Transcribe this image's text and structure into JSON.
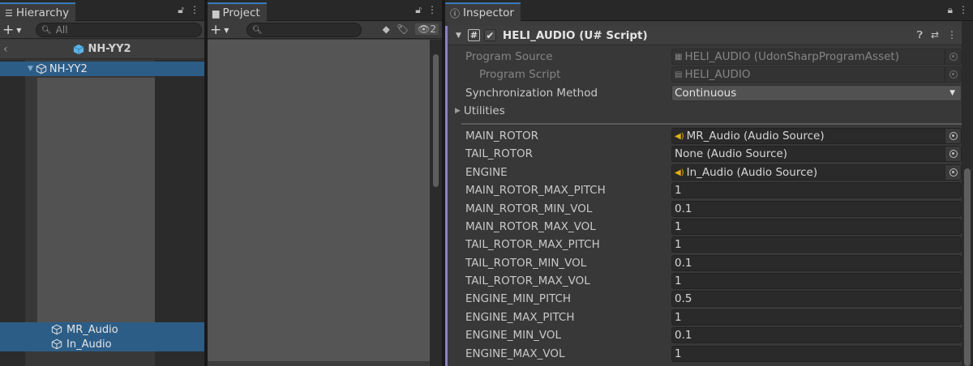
{
  "hierarchy": {
    "tab_label": "Hierarchy",
    "search_placeholder": "All",
    "scene_name": "NH-YY2",
    "items": [
      {
        "label": "NH-YY2"
      },
      {
        "label": "MR_Audio"
      },
      {
        "label": "In_Audio"
      }
    ]
  },
  "project": {
    "tab_label": "Project",
    "hidden_count": "2"
  },
  "inspector": {
    "tab_label": "Inspector",
    "component_title": "HELI_AUDIO (U# Script)",
    "program_source": {
      "label": "Program Source",
      "value": "HELI_AUDIO (UdonSharpProgramAsset)"
    },
    "program_script": {
      "label": "Program Script",
      "value": "HELI_AUDIO"
    },
    "sync_method": {
      "label": "Synchronization Method",
      "value": "Continuous"
    },
    "utilities_label": "Utilities",
    "fields": [
      {
        "label": "MAIN_ROTOR",
        "value": "MR_Audio (Audio Source)"
      },
      {
        "label": "TAIL_ROTOR",
        "value": "None (Audio Source)"
      },
      {
        "label": "ENGINE",
        "value": "In_Audio (Audio Source)"
      },
      {
        "label": "MAIN_ROTOR_MAX_PITCH",
        "value": "1"
      },
      {
        "label": "MAIN_ROTOR_MIN_VOL",
        "value": "0.1"
      },
      {
        "label": "MAIN_ROTOR_MAX_VOL",
        "value": "1"
      },
      {
        "label": "TAIL_ROTOR_MAX_PITCH",
        "value": "1"
      },
      {
        "label": "TAIL_ROTOR_MIN_VOL",
        "value": "0.1"
      },
      {
        "label": "TAIL_ROTOR_MAX_VOL",
        "value": "1"
      },
      {
        "label": "ENGINE_MIN_PITCH",
        "value": "0.5"
      },
      {
        "label": "ENGINE_MAX_PITCH",
        "value": "1"
      },
      {
        "label": "ENGINE_MIN_VOL",
        "value": "0.1"
      },
      {
        "label": "ENGINE_MAX_VOL",
        "value": "1"
      }
    ]
  },
  "colors": {
    "selection": "#2c5d87",
    "accent_tab": "#3a79bb",
    "script_accent": "#8b80c9",
    "cube_icon": "#5ab4e8"
  }
}
